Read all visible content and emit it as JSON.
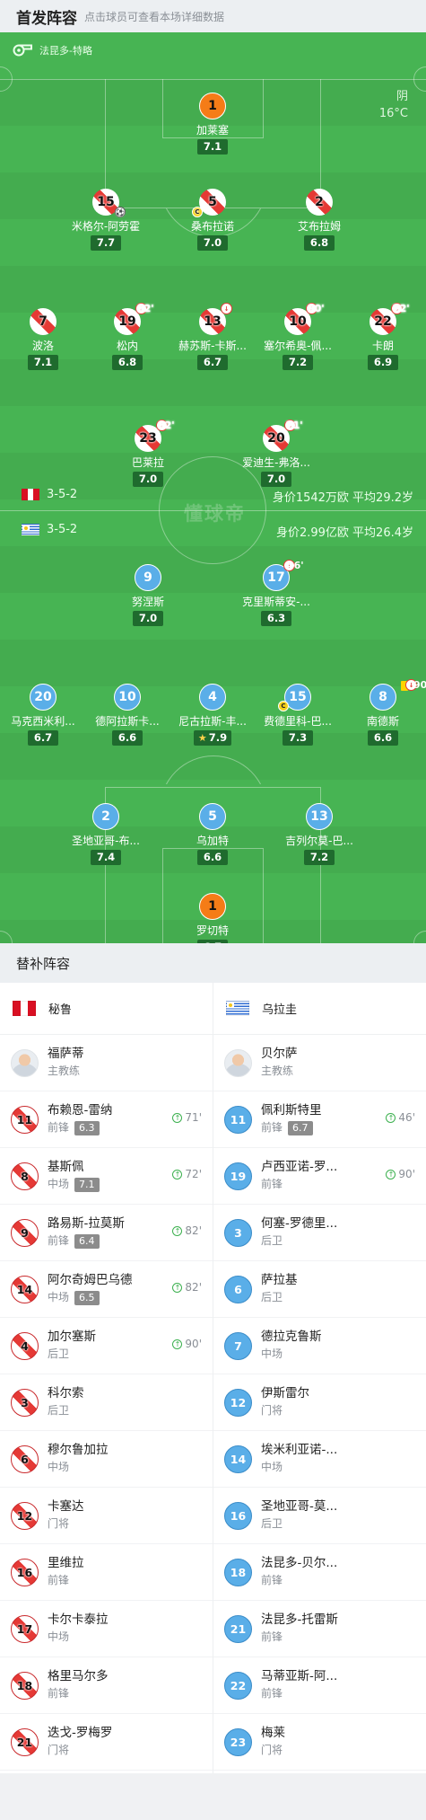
{
  "starting": {
    "title": "首发阵容",
    "hint": "点击球员可查看本场详细数据"
  },
  "pitch": {
    "referee": "法昆多-特略",
    "weather": "阴",
    "temperature": "16°C",
    "watermark": "懂球帝",
    "home_formation": "3-5-2",
    "home_value": "身价1542万欧  平均29.2岁",
    "away_formation": "3-5-2",
    "away_value": "身价2.99亿欧  平均26.4岁"
  },
  "home_players": [
    {
      "num": "1",
      "name": "加莱塞",
      "rating": "7.1",
      "gk": true
    },
    {
      "num": "15",
      "name": "米格尔-阿劳霍",
      "rating": "7.7",
      "ball": true
    },
    {
      "num": "5",
      "name": "桑布拉诺",
      "rating": "7.0",
      "captain": true
    },
    {
      "num": "2",
      "name": "艾布拉姆",
      "rating": "6.8"
    },
    {
      "num": "7",
      "name": "波洛",
      "rating": "7.1"
    },
    {
      "num": "19",
      "name": "松内",
      "rating": "6.8",
      "sub_off": "82'"
    },
    {
      "num": "13",
      "name": "赫苏斯-卡斯...",
      "rating": "6.7",
      "sub_off": ""
    },
    {
      "num": "10",
      "name": "塞尔希奥-佩...",
      "rating": "7.2",
      "sub_off": "90'"
    },
    {
      "num": "22",
      "name": "卡朗",
      "rating": "6.9",
      "sub_off": "72'"
    },
    {
      "num": "23",
      "name": "巴莱拉",
      "rating": "7.0",
      "sub_off": "82'"
    },
    {
      "num": "20",
      "name": "爱迪生-弗洛...",
      "rating": "7.0",
      "sub_off": "71'"
    }
  ],
  "away_players": [
    {
      "num": "9",
      "name": "努涅斯",
      "rating": "7.0"
    },
    {
      "num": "17",
      "name": "克里斯蒂安-...",
      "rating": "6.3",
      "sub_off": "46'"
    },
    {
      "num": "20",
      "name": "马克西米利...",
      "rating": "6.7"
    },
    {
      "num": "10",
      "name": "德阿拉斯卡...",
      "rating": "6.6"
    },
    {
      "num": "4",
      "name": "尼古拉斯-丰...",
      "rating": "7.9",
      "star": true
    },
    {
      "num": "15",
      "name": "费德里科-巴...",
      "rating": "7.3",
      "captain": true
    },
    {
      "num": "8",
      "name": "南德斯",
      "rating": "6.6",
      "sub_off": "90",
      "yellow": true
    },
    {
      "num": "2",
      "name": "圣地亚哥-布...",
      "rating": "7.4"
    },
    {
      "num": "5",
      "name": "乌加特",
      "rating": "6.6"
    },
    {
      "num": "13",
      "name": "吉列尔莫-巴...",
      "rating": "7.2"
    },
    {
      "num": "1",
      "name": "罗切特",
      "rating": "6.7",
      "gk": true
    }
  ],
  "subs": {
    "title": "替补阵容",
    "home_team": "秘鲁",
    "away_team": "乌拉圭",
    "home": [
      {
        "num": "",
        "name": "福萨蒂",
        "pos": "主教练",
        "coach": true
      },
      {
        "num": "11",
        "name": "布赖恩-雷纳",
        "pos": "前锋",
        "rating": "6.3",
        "in": "71'"
      },
      {
        "num": "8",
        "name": "基斯佩",
        "pos": "中场",
        "rating": "7.1",
        "in": "72'"
      },
      {
        "num": "9",
        "name": "路易斯-拉莫斯",
        "pos": "前锋",
        "rating": "6.4",
        "in": "82'"
      },
      {
        "num": "14",
        "name": "阿尔奇姆巴乌德",
        "pos": "中场",
        "rating": "6.5",
        "in": "82'"
      },
      {
        "num": "4",
        "name": "加尔塞斯",
        "pos": "后卫",
        "in": "90'"
      },
      {
        "num": "3",
        "name": "科尔索",
        "pos": "后卫"
      },
      {
        "num": "6",
        "name": "穆尔鲁加拉",
        "pos": "中场"
      },
      {
        "num": "12",
        "name": "卡塞达",
        "pos": "门将"
      },
      {
        "num": "16",
        "name": "里维拉",
        "pos": "前锋"
      },
      {
        "num": "17",
        "name": "卡尔卡泰拉",
        "pos": "中场"
      },
      {
        "num": "18",
        "name": "格里马尔多",
        "pos": "前锋"
      },
      {
        "num": "21",
        "name": "迭戈-罗梅罗",
        "pos": "门将"
      }
    ],
    "away": [
      {
        "num": "",
        "name": "贝尔萨",
        "pos": "主教练",
        "coach": true
      },
      {
        "num": "11",
        "name": "佩利斯特里",
        "pos": "前锋",
        "rating": "6.7",
        "in": "46'"
      },
      {
        "num": "19",
        "name": "卢西亚诺-罗...",
        "pos": "前锋",
        "in": "90'"
      },
      {
        "num": "3",
        "name": "何塞-罗德里...",
        "pos": "后卫"
      },
      {
        "num": "6",
        "name": "萨拉基",
        "pos": "后卫"
      },
      {
        "num": "7",
        "name": "德拉克鲁斯",
        "pos": "中场"
      },
      {
        "num": "12",
        "name": "伊斯雷尔",
        "pos": "门将"
      },
      {
        "num": "14",
        "name": "埃米利亚诺-...",
        "pos": "中场"
      },
      {
        "num": "16",
        "name": "圣地亚哥-莫...",
        "pos": "后卫"
      },
      {
        "num": "18",
        "name": "法昆多-贝尔...",
        "pos": "前锋"
      },
      {
        "num": "21",
        "name": "法昆多-托雷斯",
        "pos": "前锋"
      },
      {
        "num": "22",
        "name": "马蒂亚斯-阿...",
        "pos": "前锋"
      },
      {
        "num": "23",
        "name": "梅莱",
        "pos": "门将"
      }
    ]
  }
}
